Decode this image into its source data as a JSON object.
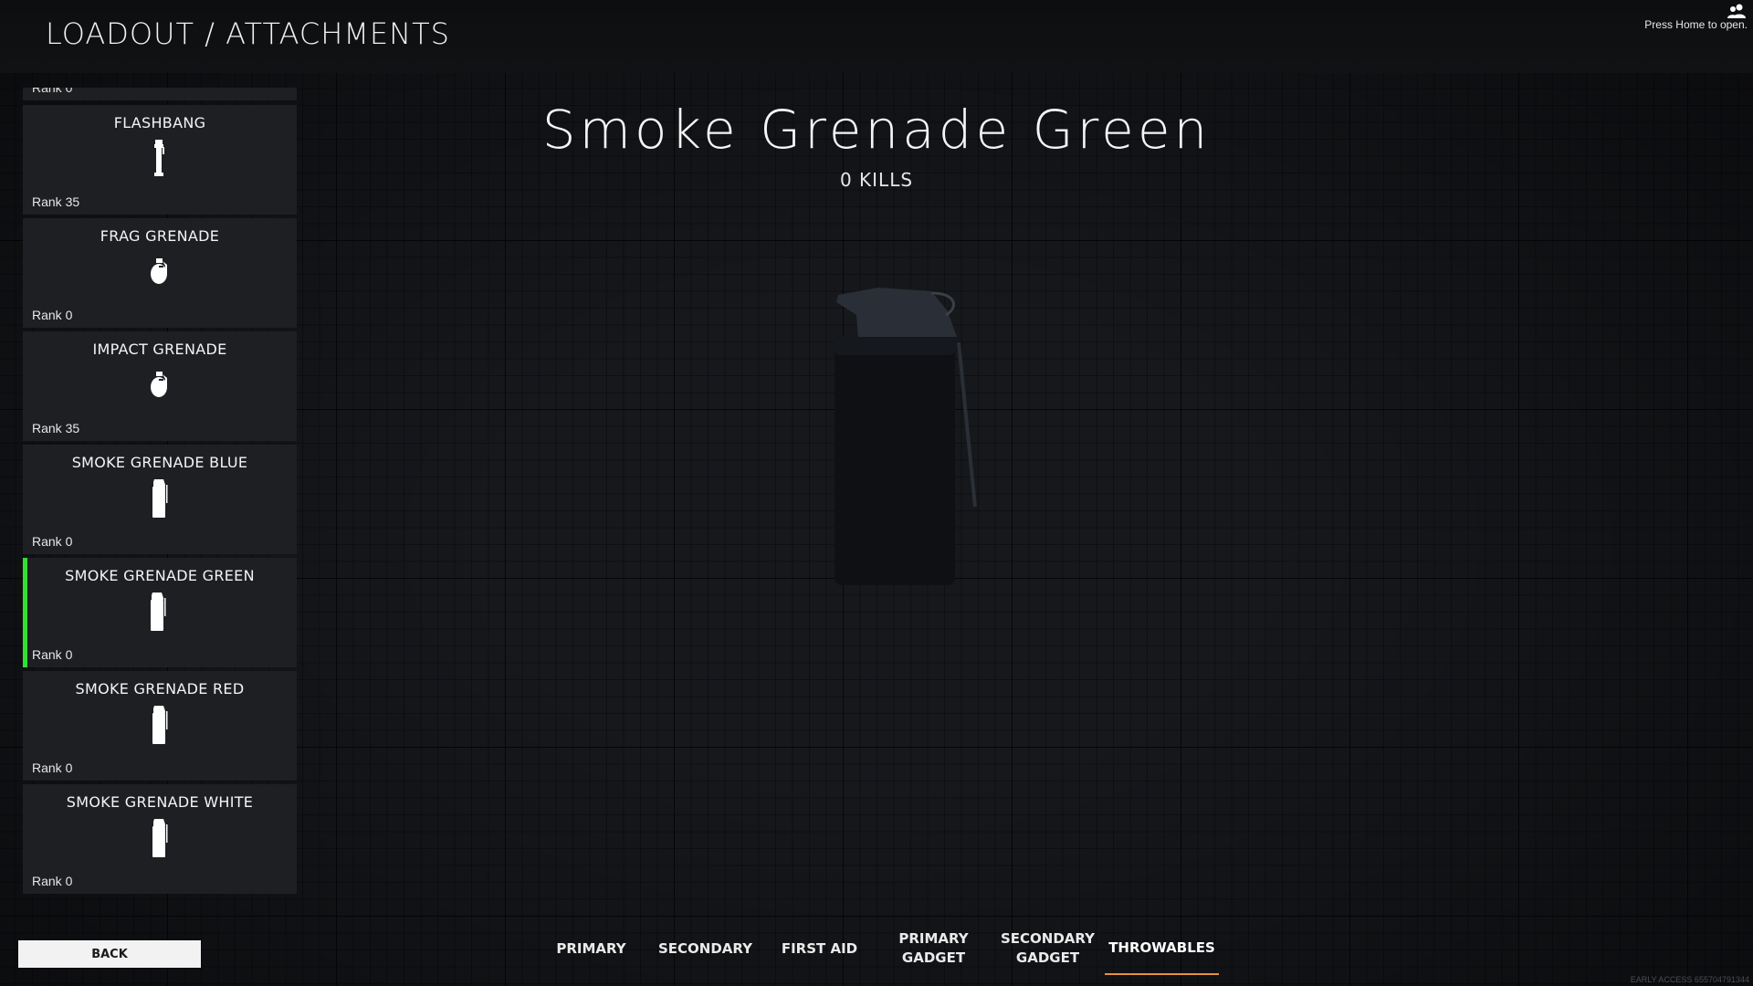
{
  "header": {
    "title": "LOADOUT / ATTACHMENTS"
  },
  "social": {
    "icon": "friends-icon",
    "hint": "Press Home to open."
  },
  "list": {
    "partial_rank": "Rank 0",
    "items": [
      {
        "name": "FLASHBANG",
        "rank": "Rank 35",
        "icon": "flashbang-icon",
        "selected": false
      },
      {
        "name": "FRAG GRENADE",
        "rank": "Rank 0",
        "icon": "frag-grenade-icon",
        "selected": false
      },
      {
        "name": "IMPACT GRENADE",
        "rank": "Rank 35",
        "icon": "impact-grenade-icon",
        "selected": false
      },
      {
        "name": "SMOKE GRENADE BLUE",
        "rank": "Rank 0",
        "icon": "smoke-grenade-icon",
        "selected": false
      },
      {
        "name": "SMOKE GRENADE GREEN",
        "rank": "Rank 0",
        "icon": "smoke-grenade-icon",
        "selected": true
      },
      {
        "name": "SMOKE GRENADE RED",
        "rank": "Rank 0",
        "icon": "smoke-grenade-icon",
        "selected": false
      },
      {
        "name": "SMOKE GRENADE WHITE",
        "rank": "Rank 0",
        "icon": "smoke-grenade-icon",
        "selected": false
      }
    ]
  },
  "weapon": {
    "name": "Smoke Grenade Green",
    "kills": "0 KILLS",
    "model_icon": "smoke-grenade-model"
  },
  "footer": {
    "back_label": "BACK",
    "tabs": [
      {
        "label": "PRIMARY",
        "active": false
      },
      {
        "label": "SECONDARY",
        "active": false
      },
      {
        "label": "FIRST AID",
        "active": false
      },
      {
        "label": "PRIMARY\nGADGET",
        "active": false
      },
      {
        "label": "SECONDARY\nGADGET",
        "active": false
      },
      {
        "label": "THROWABLES",
        "active": true
      }
    ],
    "version": "EARLY ACCESS 655704791344"
  },
  "colors": {
    "selected_accent": "#32e032",
    "active_tab_underline": "#e8923a"
  }
}
